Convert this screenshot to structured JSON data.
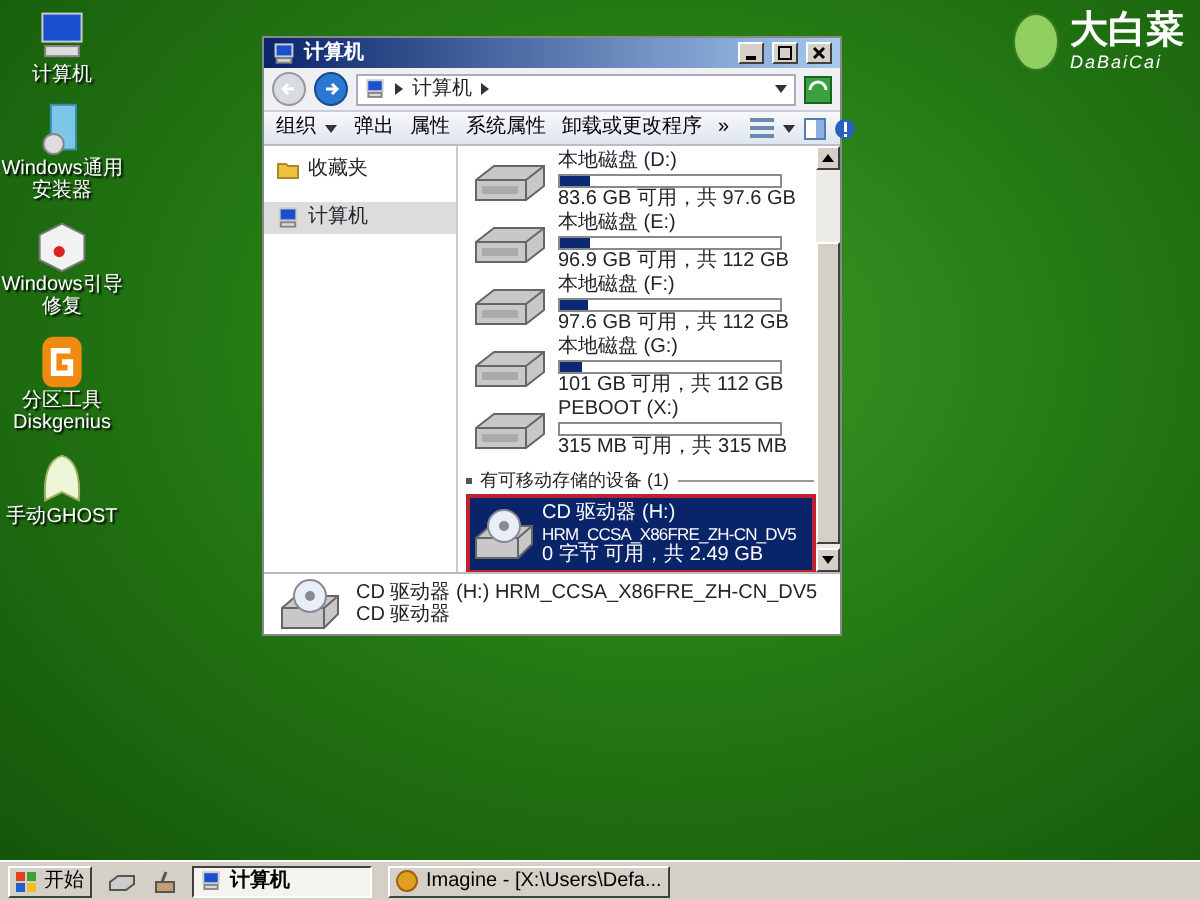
{
  "desktop_icons": [
    {
      "kind": "computer",
      "label": "计算机"
    },
    {
      "kind": "installer",
      "label": "Windows通用安装器"
    },
    {
      "kind": "repair",
      "label": "Windows引导修复"
    },
    {
      "kind": "partition",
      "label": "分区工具\nDiskgenius"
    },
    {
      "kind": "ghost",
      "label": "手动GHOST"
    }
  ],
  "logo": {
    "title": "大白菜",
    "subtitle": "DaBaiCai"
  },
  "window": {
    "title": "计算机",
    "address": "计算机",
    "toolbar": [
      {
        "label": "组织",
        "dropdown": true
      },
      {
        "label": "弹出",
        "dropdown": false
      },
      {
        "label": "属性",
        "dropdown": false
      },
      {
        "label": "系统属性",
        "dropdown": false
      },
      {
        "label": "卸载或更改程序",
        "dropdown": false
      },
      {
        "label": "»",
        "dropdown": false
      }
    ],
    "sidebar": [
      {
        "kind": "favorites",
        "label": "收藏夹",
        "selected": false
      },
      {
        "kind": "computer",
        "label": "计算机",
        "selected": true
      }
    ],
    "drives": [
      {
        "name": "本地磁盘 (D:)",
        "level": 0.14,
        "info": "83.6 GB 可用，共 97.6 GB",
        "selected": false
      },
      {
        "name": "本地磁盘 (E:)",
        "level": 0.14,
        "info": "96.9 GB 可用，共 112 GB",
        "selected": false
      },
      {
        "name": "本地磁盘 (F:)",
        "level": 0.13,
        "info": "97.6 GB 可用，共 112 GB",
        "selected": false
      },
      {
        "name": "本地磁盘 (G:)",
        "level": 0.1,
        "info": "101 GB 可用，共 112 GB",
        "selected": false
      },
      {
        "name": "PEBOOT (X:)",
        "level": 0,
        "info": "315 MB 可用，共 315 MB",
        "selected": false
      }
    ],
    "removable": {
      "header": "有可移动存储的设备 (1)",
      "items": [
        {
          "name": "CD 驱动器 (H:)",
          "volume": "HRM_CCSA_X86FRE_ZH-CN_DV5",
          "info": "0 字节 可用，共 2.49 GB",
          "selected": true
        }
      ]
    },
    "details": {
      "title": "CD 驱动器 (H:) HRM_CCSA_X86FRE_ZH-CN_DV5",
      "subtitle": "CD 驱动器"
    }
  },
  "taskbar": {
    "start": "开始",
    "tasks": [
      {
        "label": "计算机",
        "selected": true
      },
      {
        "label": "Imagine - [X:\\Users\\Defa...",
        "selected": false
      }
    ]
  }
}
